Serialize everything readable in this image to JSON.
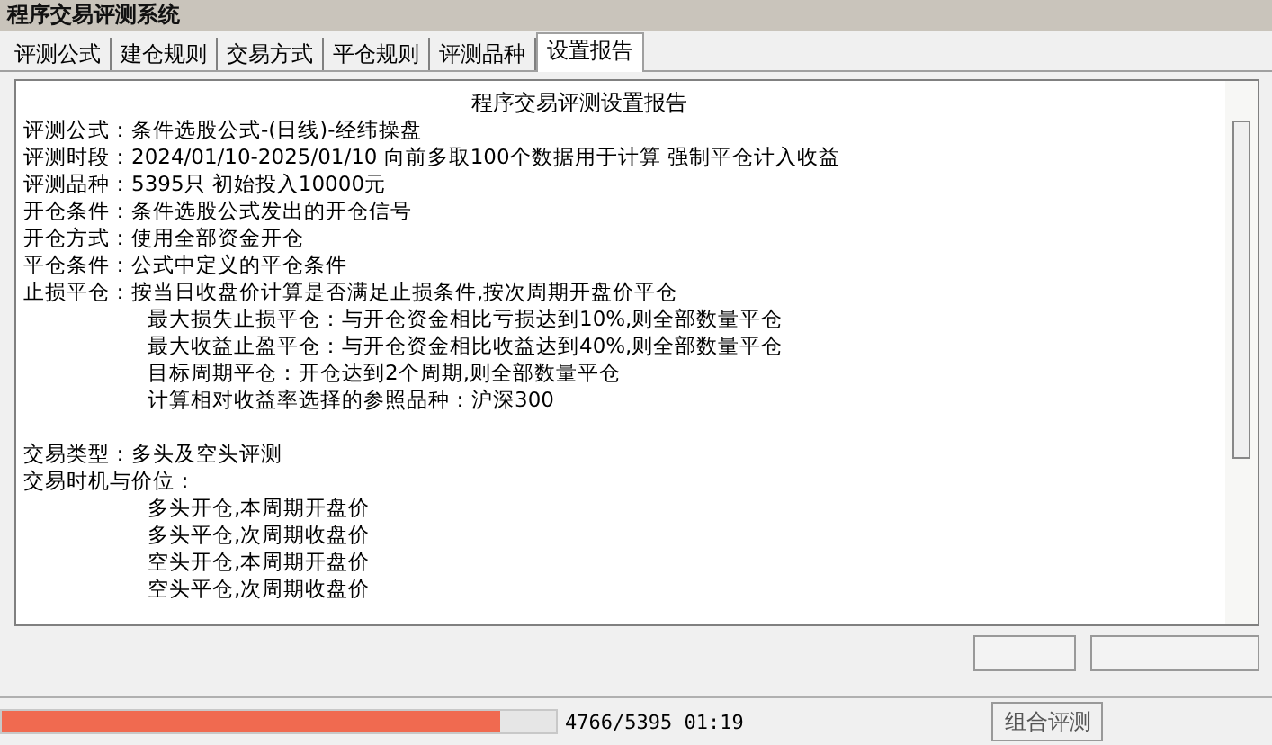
{
  "window": {
    "title": "程序交易评测系统"
  },
  "tabs": [
    {
      "label": "评测公式",
      "selected": false
    },
    {
      "label": "建仓规则",
      "selected": false
    },
    {
      "label": "交易方式",
      "selected": false
    },
    {
      "label": "平仓规则",
      "selected": false
    },
    {
      "label": "评测品种",
      "selected": false
    },
    {
      "label": "设置报告",
      "selected": true
    }
  ],
  "report": {
    "title": "程序交易评测设置报告",
    "lines": [
      {
        "kind": "field",
        "label": "评测公式：",
        "value": "条件选股公式-(日线)-经纬操盘"
      },
      {
        "kind": "field",
        "label": "评测时段：",
        "value": "2024/01/10-2025/01/10 向前多取100个数据用于计算 强制平仓计入收益"
      },
      {
        "kind": "field",
        "label": "评测品种：",
        "value": "5395只 初始投入10000元"
      },
      {
        "kind": "field",
        "label": "开仓条件：",
        "value": "条件选股公式发出的开仓信号"
      },
      {
        "kind": "field",
        "label": "开仓方式：",
        "value": "使用全部资金开仓"
      },
      {
        "kind": "field",
        "label": "平仓条件：",
        "value": "公式中定义的平仓条件"
      },
      {
        "kind": "field",
        "label": "止损平仓：",
        "value": "按当日收盘价计算是否满足止损条件,按次周期开盘价平仓"
      },
      {
        "kind": "indented",
        "text": "最大损失止损平仓：与开仓资金相比亏损达到10%,则全部数量平仓"
      },
      {
        "kind": "indented",
        "text": "最大收益止盈平仓：与开仓资金相比收益达到40%,则全部数量平仓"
      },
      {
        "kind": "indented",
        "text": "目标周期平仓：开仓达到2个周期,则全部数量平仓"
      },
      {
        "kind": "indented",
        "text": "计算相对收益率选择的参照品种：沪深300"
      },
      {
        "kind": "gap"
      },
      {
        "kind": "field",
        "label": "交易类型：",
        "value": "多头及空头评测"
      },
      {
        "kind": "field",
        "label": "交易时机与价位："
      },
      {
        "kind": "indented",
        "text": "多头开仓,本周期开盘价"
      },
      {
        "kind": "indented",
        "text": "多头平仓,次周期收盘价"
      },
      {
        "kind": "indented",
        "text": "空头开仓,本周期开盘价"
      },
      {
        "kind": "indented",
        "text": "空头平仓,次周期收盘价"
      }
    ]
  },
  "progress": {
    "level": 0.9,
    "reading": "4766/5395 01:19"
  },
  "buttons": [
    {
      "label": "组合评测"
    }
  ]
}
